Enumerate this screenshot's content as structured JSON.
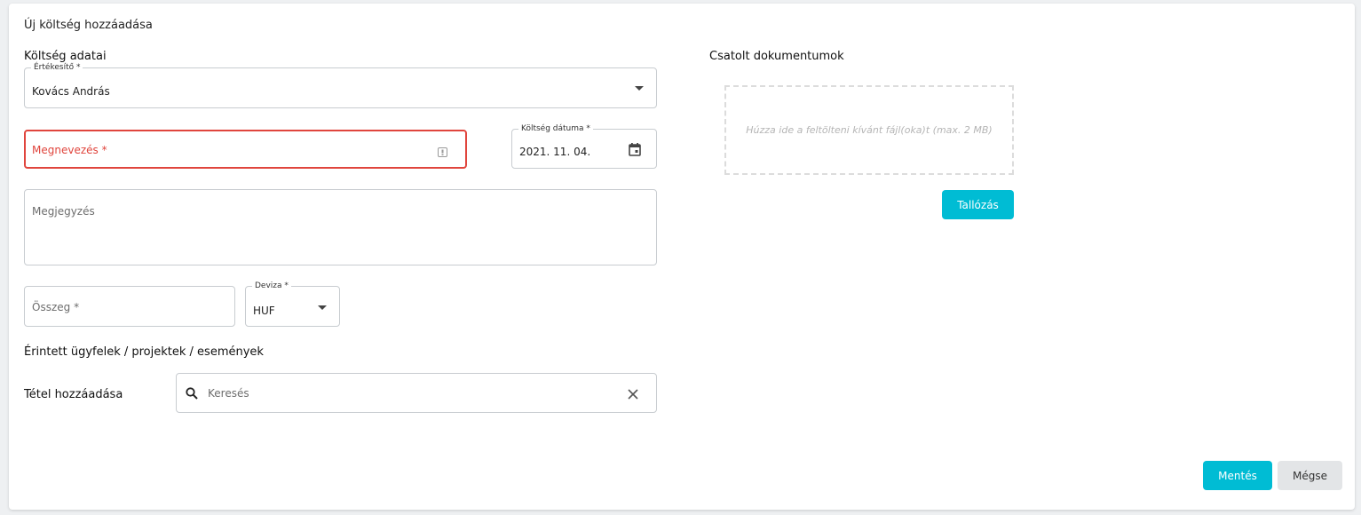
{
  "dialog": {
    "title": "Új költség hozzáadása"
  },
  "expense": {
    "section_title": "Költség adatai",
    "seller": {
      "label": "Értékesítő *",
      "value": "Kovács András"
    },
    "name": {
      "placeholder": "Megnevezés *"
    },
    "date": {
      "label": "Költség dátuma *",
      "value": "2021. 11. 04."
    },
    "note": {
      "placeholder": "Megjegyzés"
    },
    "amount": {
      "placeholder": "Összeg *"
    },
    "currency": {
      "label": "Deviza *",
      "value": "HUF"
    }
  },
  "related": {
    "section_title": "Érintett ügyfelek / projektek / események",
    "add_label": "Tétel hozzáadása",
    "search_placeholder": "Keresés"
  },
  "attachments": {
    "section_title": "Csatolt dokumentumok",
    "dropzone_text": "Húzza ide a feltölteni kívánt fájl(oka)t (max. 2 MB)",
    "browse_label": "Tallózás"
  },
  "footer": {
    "save_label": "Mentés",
    "cancel_label": "Mégse"
  },
  "colors": {
    "accent": "#00bcd4",
    "error": "#e0453d"
  },
  "icons": {
    "dropdown": "chevron-down-icon",
    "calendar": "calendar-icon",
    "search": "search-icon",
    "clear": "close-icon",
    "badge": "keyboard-icon"
  }
}
